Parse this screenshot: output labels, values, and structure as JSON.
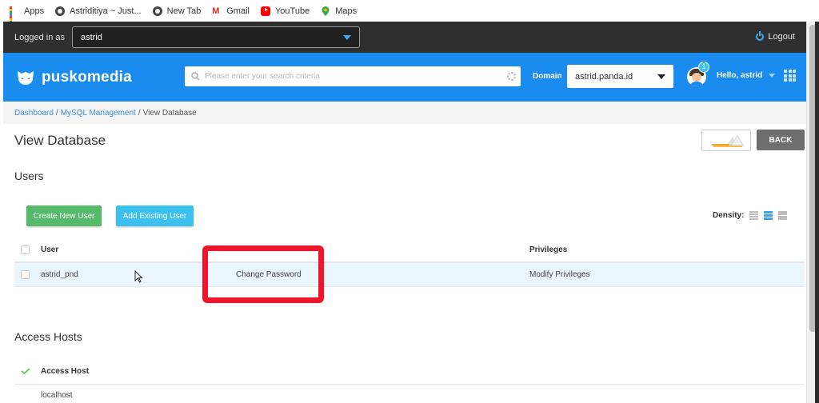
{
  "bookmarks": [
    {
      "label": "Apps",
      "icon": "apps-icon"
    },
    {
      "label": "Astriditiya ~ Just...",
      "icon": "globe-icon"
    },
    {
      "label": "New Tab",
      "icon": "globe-icon"
    },
    {
      "label": "Gmail",
      "icon": "gmail-icon"
    },
    {
      "label": "YouTube",
      "icon": "youtube-icon"
    },
    {
      "label": "Maps",
      "icon": "maps-icon"
    }
  ],
  "topbar": {
    "logged_in_label": "Logged in as",
    "account": "astrid",
    "logout": "Logout"
  },
  "header": {
    "brand": "puskomedia",
    "search_placeholder": "Please enter your search criteria",
    "domain_label": "Domain",
    "domain_value": "astrid.panda.id",
    "notification_count": "1",
    "greeting": "Hello, astrid"
  },
  "breadcrumb": {
    "items": [
      "Dashboard",
      "MySQL Management",
      "View Database"
    ]
  },
  "page": {
    "title": "View Database",
    "back_label": "BACK"
  },
  "users": {
    "section_title": "Users",
    "create_button": "Create New User",
    "add_button": "Add Existing User",
    "density_label": "Density:",
    "columns": [
      "User",
      "Privileges"
    ],
    "rows": [
      {
        "user": "astrid_pnd",
        "action": "Change Password",
        "privileges": "Modify Privileges"
      }
    ]
  },
  "access_hosts": {
    "section_title": "Access Hosts",
    "column": "Access Host",
    "rows": [
      "localhost"
    ]
  },
  "colors": {
    "header_blue": "#1a8cf0",
    "green_button": "#55bb6a",
    "cyan_button": "#3cc1ee",
    "highlight_red": "#f2142a"
  }
}
